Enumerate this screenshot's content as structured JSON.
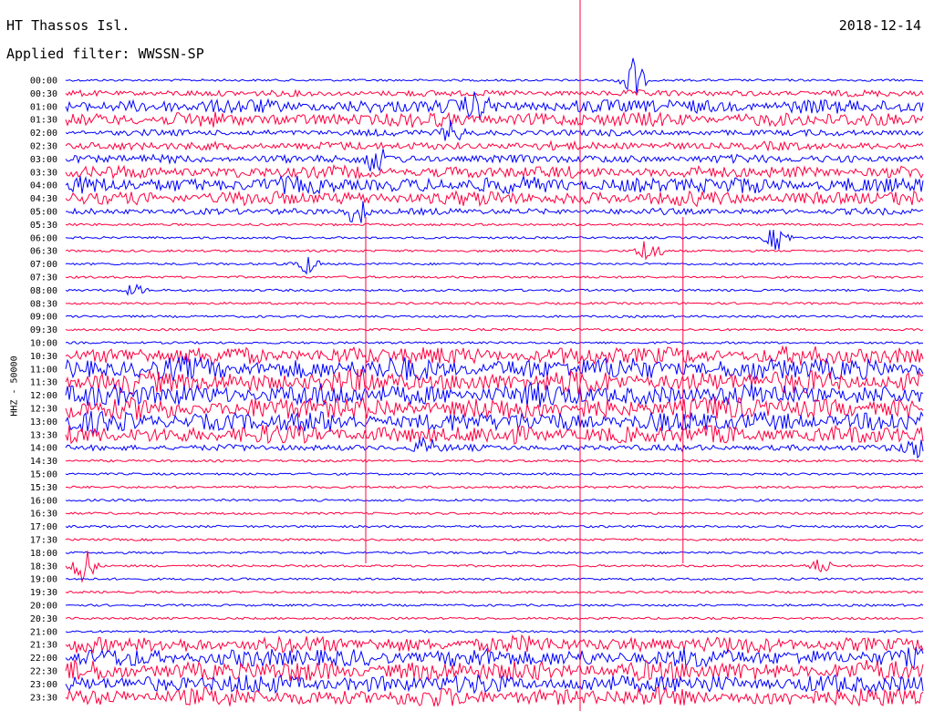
{
  "header": {
    "station": "HT Thassos Isl.",
    "date": "2018-12-14",
    "filter": "Applied filter: WWSSN-SP"
  },
  "chart_data": {
    "type": "line",
    "title": "HT Thassos Isl.",
    "ylabel": "HHZ - 50000",
    "row_labels": [
      "00:00",
      "00:30",
      "01:00",
      "01:30",
      "02:00",
      "02:30",
      "03:00",
      "03:30",
      "04:00",
      "04:30",
      "05:00",
      "05:30",
      "06:00",
      "06:30",
      "07:00",
      "07:30",
      "08:00",
      "08:30",
      "09:00",
      "09:30",
      "10:00",
      "10:30",
      "11:00",
      "11:30",
      "12:00",
      "12:30",
      "13:00",
      "13:30",
      "14:00",
      "14:30",
      "15:00",
      "15:30",
      "16:00",
      "16:30",
      "17:00",
      "17:30",
      "18:00",
      "18:30",
      "19:00",
      "19:30",
      "20:00",
      "20:30",
      "21:00",
      "21:30",
      "22:00",
      "22:30",
      "23:00",
      "23:30"
    ],
    "colors": {
      "even_rows": "#0000ff",
      "odd_rows": "#ff0040"
    },
    "noise_level": [
      1,
      2,
      6,
      6,
      2,
      3,
      3,
      5,
      7,
      6,
      2,
      1,
      1,
      1,
      1,
      1,
      1,
      1,
      1,
      1,
      1,
      8,
      10,
      10,
      10,
      10,
      9,
      8,
      2,
      1,
      1,
      1,
      1,
      1,
      1,
      1,
      1,
      1,
      1,
      1,
      1,
      1,
      1,
      7,
      8,
      9,
      8,
      8
    ],
    "events": [
      {
        "row": 0,
        "x": 0.66,
        "amp": 28
      },
      {
        "row": 2,
        "x": 0.48,
        "amp": 10
      },
      {
        "row": 4,
        "x": 0.45,
        "amp": 12
      },
      {
        "row": 6,
        "x": 0.36,
        "amp": 14
      },
      {
        "row": 10,
        "x": 0.34,
        "amp": 16
      },
      {
        "row": 12,
        "x": 0.83,
        "amp": 14
      },
      {
        "row": 13,
        "x": 0.68,
        "amp": 16
      },
      {
        "row": 14,
        "x": 0.28,
        "amp": 12
      },
      {
        "row": 16,
        "x": 0.08,
        "amp": 6
      },
      {
        "row": 28,
        "x": 0.42,
        "amp": 10
      },
      {
        "row": 28,
        "x": 0.99,
        "amp": 10
      },
      {
        "row": 37,
        "x": 0.02,
        "amp": 24
      },
      {
        "row": 37,
        "x": 0.88,
        "amp": 8
      }
    ],
    "vertical_spikes": [
      0.35,
      0.6,
      0.72
    ]
  }
}
